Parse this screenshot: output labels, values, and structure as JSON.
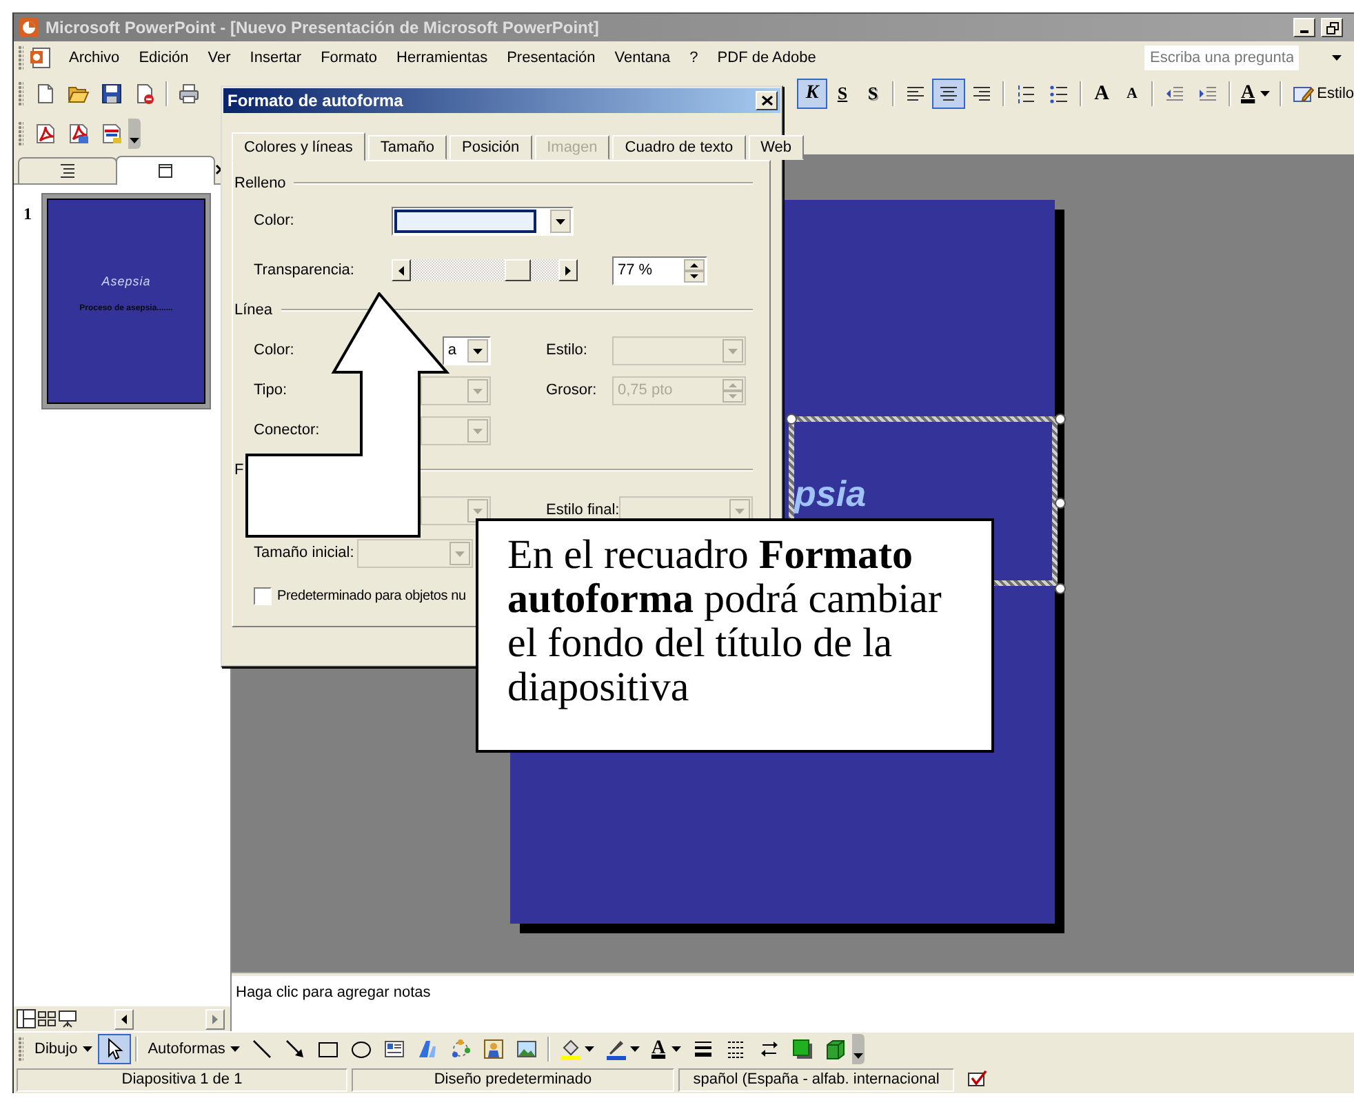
{
  "window": {
    "title": "Microsoft PowerPoint - [Nuevo Presentación de Microsoft PowerPoint]"
  },
  "menu": {
    "items": [
      "Archivo",
      "Edición",
      "Ver",
      "Insertar",
      "Formato",
      "Herramientas",
      "Presentación",
      "Ventana",
      "?",
      "PDF de Adobe"
    ],
    "help_search": {
      "placeholder": "Escriba una pregunta"
    }
  },
  "standard_toolbar": [
    [
      {
        "kind": "new"
      },
      {
        "kind": "open"
      },
      {
        "kind": "save"
      },
      {
        "kind": "permission"
      }
    ],
    [
      {
        "kind": "print"
      }
    ]
  ],
  "formatting_toolbar": [
    [
      {
        "kind": "italic",
        "label": "K",
        "pressed": true
      },
      {
        "kind": "underline",
        "label": "S",
        "pressed": false
      },
      {
        "kind": "shadow",
        "label": "S",
        "pressed": false
      }
    ],
    [
      {
        "kind": "align_left",
        "pressed": false
      },
      {
        "kind": "align_center",
        "pressed": true
      },
      {
        "kind": "align_right",
        "pressed": false
      }
    ],
    [
      {
        "kind": "numbering",
        "pressed": false
      },
      {
        "kind": "bullets",
        "pressed": false
      }
    ],
    [
      {
        "kind": "grow_font",
        "label": "A",
        "pressed": false
      },
      {
        "kind": "shrink_font",
        "label": "A",
        "pressed": false
      }
    ],
    [
      {
        "kind": "outdent",
        "pressed": false
      },
      {
        "kind": "indent",
        "pressed": false
      }
    ],
    [
      {
        "kind": "font_color",
        "label": "A",
        "pressed": false
      }
    ],
    [
      {
        "kind": "style",
        "label": "Estilo",
        "pressed": false
      }
    ]
  ],
  "pdf_toolbar": [
    {
      "kind": "pdf_create"
    },
    {
      "kind": "pdf_email"
    },
    {
      "kind": "pdf_review"
    }
  ],
  "slide_pane": {
    "tabs": [
      {
        "kind": "outline",
        "selected": false
      },
      {
        "kind": "slides",
        "selected": true
      }
    ],
    "slides": [
      {
        "number": "1",
        "title": "Asepsia",
        "subtitle": "Proceso de asepsia.......",
        "selected": true
      }
    ]
  },
  "slide": {
    "title_visible": "psia",
    "title_selected": true
  },
  "notes": {
    "hint": "Haga clic para agregar notas"
  },
  "drawing_toolbar": [
    [
      {
        "kind": "menu",
        "label": "Dibujo",
        "pressed": false
      },
      {
        "kind": "select",
        "pressed": true
      }
    ],
    [
      {
        "kind": "menu",
        "label": "Autoformas",
        "pressed": false
      },
      {
        "kind": "line",
        "pressed": false
      },
      {
        "kind": "arrow",
        "pressed": false
      },
      {
        "kind": "rectangle",
        "pressed": false
      },
      {
        "kind": "oval",
        "pressed": false
      },
      {
        "kind": "textbox",
        "pressed": false
      },
      {
        "kind": "wordart",
        "pressed": false
      },
      {
        "kind": "diagram",
        "pressed": false
      },
      {
        "kind": "clipart",
        "pressed": false
      },
      {
        "kind": "picture_insert",
        "pressed": false
      }
    ],
    [
      {
        "kind": "fill_color",
        "pressed": false
      },
      {
        "kind": "line_color",
        "pressed": false
      },
      {
        "kind": "font_color",
        "label": "A",
        "pressed": false
      },
      {
        "kind": "line_style",
        "pressed": false
      },
      {
        "kind": "dash_style",
        "pressed": false
      },
      {
        "kind": "arrow_style",
        "pressed": false
      },
      {
        "kind": "shadow_style",
        "pressed": false
      },
      {
        "kind": "threed_style",
        "pressed": false
      }
    ]
  ],
  "status_bar": [
    "Diapositiva 1 de 1",
    "Diseño predeterminado",
    "spañol (España - alfab. internacional"
  ],
  "dialog": {
    "title": "Formato de autoforma",
    "tabs": [
      {
        "label": "Colores y líneas",
        "selected": true,
        "disabled": false
      },
      {
        "label": "Tamaño",
        "selected": false,
        "disabled": false
      },
      {
        "label": "Posición",
        "selected": false,
        "disabled": false
      },
      {
        "label": "Imagen",
        "selected": false,
        "disabled": true
      },
      {
        "label": "Cuadro de texto",
        "selected": false,
        "disabled": false
      },
      {
        "label": "Web",
        "selected": false,
        "disabled": false
      }
    ],
    "sections": [
      {
        "kind": "fill",
        "heading": "Relleno",
        "rows": [
          [
            {
              "kind": "color_combo",
              "label": "Color:",
              "color": "#e8f1fc",
              "disabled": false
            }
          ],
          [
            {
              "kind": "slider",
              "label": "Transparencia:",
              "level": 0.77,
              "value": "77 %",
              "disabled": false
            }
          ]
        ]
      },
      {
        "kind": "line",
        "heading": "Línea",
        "rows": [
          [
            {
              "kind": "combo",
              "label": "Color:",
              "value": "a",
              "disabled": false
            },
            {
              "kind": "combo",
              "label": "Estilo:",
              "disabled": true
            }
          ],
          [
            {
              "kind": "combo",
              "label": "Tipo:",
              "disabled": true
            },
            {
              "kind": "spin",
              "label": "Grosor:",
              "value": "0,75 pto",
              "disabled": true
            }
          ],
          [
            {
              "kind": "combo",
              "label": "Conector:",
              "disabled": true
            }
          ]
        ]
      },
      {
        "kind": "arrows",
        "heading": "F",
        "rows": [
          [
            {
              "kind": "combo",
              "disabled": true
            },
            {
              "kind": "combo",
              "label": "Estilo final:",
              "disabled": true
            }
          ],
          [
            {
              "kind": "combo",
              "label": "Tamaño inicial:",
              "disabled": true
            }
          ]
        ]
      }
    ],
    "default_checkbox": {
      "label": "Predeterminado para objetos nu",
      "checked": false
    }
  },
  "callout": {
    "text": "En el recuadro **Formato autoforma** podrá cambiar el fondo del título de la diapositiva"
  }
}
